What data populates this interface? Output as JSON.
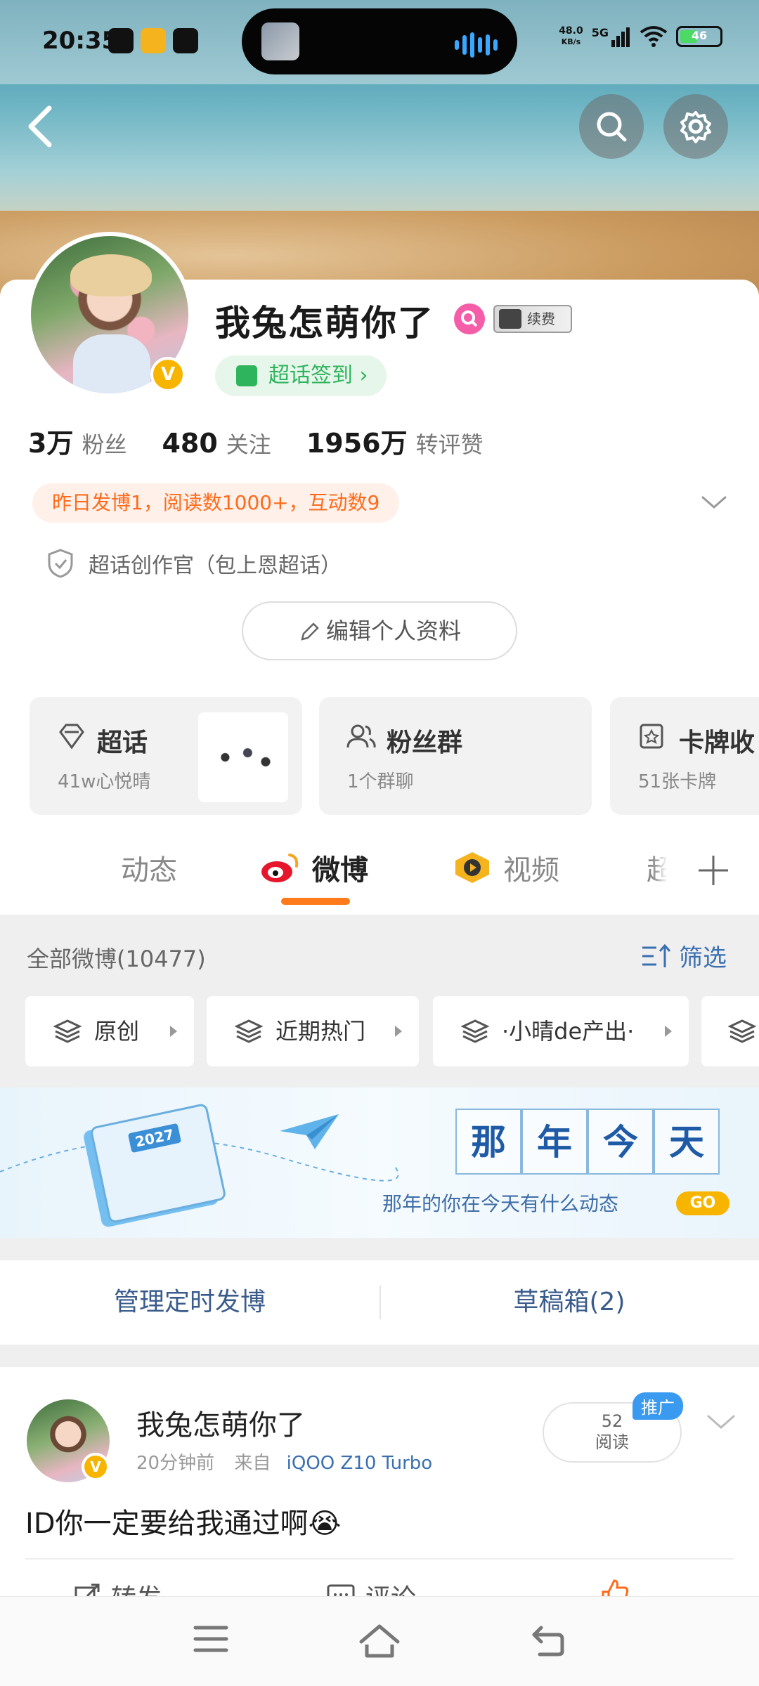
{
  "status_bar": {
    "time": "20:35",
    "net_speed": "48.0",
    "net_unit": "KB/s",
    "network": "5G",
    "battery": "46"
  },
  "header": {
    "back_icon": "chevron-left-icon",
    "search_icon": "search-icon",
    "settings_icon": "gear-icon"
  },
  "profile": {
    "name": "我兔怎萌你了",
    "vip_label": "续费",
    "verified_badge": "V",
    "checkin_label": "超话签到 ›",
    "stats": [
      {
        "num": "3万",
        "label": "粉丝"
      },
      {
        "num": "480",
        "label": "关注"
      },
      {
        "num": "1956万",
        "label": "转评赞"
      }
    ],
    "summary": "昨日发博1，阅读数1000+，互动数9",
    "badge_text": "超话创作官（包上恩超话）",
    "edit_label": "编辑个人资料"
  },
  "features": [
    {
      "title": "超话",
      "sub": "41w心悦晴"
    },
    {
      "title": "粉丝群",
      "sub": "1个群聊"
    },
    {
      "title": "卡牌收",
      "sub": "51张卡牌"
    }
  ],
  "tabs": [
    {
      "label": "动态"
    },
    {
      "label": "微博"
    },
    {
      "label": "视频"
    },
    {
      "label": "超"
    }
  ],
  "feed_header": {
    "all_label": "全部微博(10477)",
    "filter_label": "筛选"
  },
  "chips": [
    {
      "label": "原创"
    },
    {
      "label": "近期热门"
    },
    {
      "label": "·小晴de产出·"
    }
  ],
  "on_this_day": {
    "year": "2027",
    "chars": [
      "那",
      "年",
      "今",
      "天"
    ],
    "subtitle": "那年的你在今天有什么动态",
    "go": "GO"
  },
  "manage": {
    "scheduled": "管理定时发博",
    "drafts": "草稿箱(2)"
  },
  "post": {
    "author": "我兔怎萌你了",
    "time": "20分钟前",
    "source_prefix": "来自",
    "source": "iQOO Z10 Turbo",
    "read_count": "52",
    "read_label": "阅读",
    "promo": "推广",
    "text": "ID你一定要给我通过啊😭",
    "actions": [
      "转发",
      "评论",
      ""
    ]
  },
  "colors": {
    "accent_orange": "#ff7a1a",
    "link_blue": "#3a6fb0",
    "checkin_green": "#2eb45c",
    "vip_gold": "#f7b500"
  }
}
